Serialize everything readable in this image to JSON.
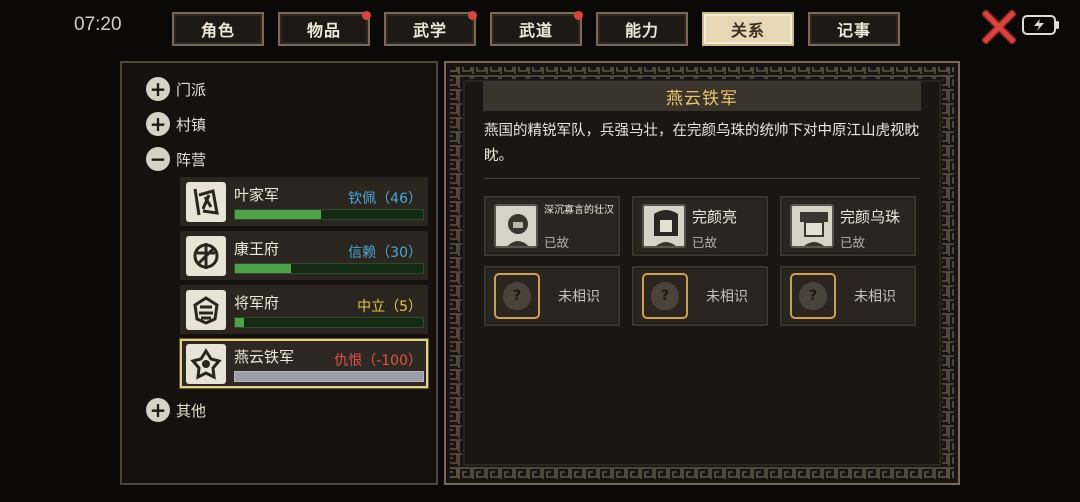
{
  "status_bar": {
    "time": "07:20"
  },
  "tabs": [
    {
      "label": "角色",
      "active": false,
      "badge": false
    },
    {
      "label": "物品",
      "active": false,
      "badge": true
    },
    {
      "label": "武学",
      "active": false,
      "badge": true
    },
    {
      "label": "武道",
      "active": false,
      "badge": true
    },
    {
      "label": "能力",
      "active": false,
      "badge": false
    },
    {
      "label": "关系",
      "active": true,
      "badge": false
    },
    {
      "label": "记事",
      "active": false,
      "badge": false
    }
  ],
  "colors": {
    "accent_gold": "#ebc56b",
    "friendly_blue": "#4aa8d8",
    "neutral_yellow": "#e6c84b",
    "hostile_red": "#e0524a",
    "bar_green": "#4ea24a"
  },
  "tree": {
    "sect": {
      "icon": "plus-icon",
      "label": "门派"
    },
    "town": {
      "icon": "plus-icon",
      "label": "村镇"
    },
    "camp": {
      "icon": "minus-icon",
      "label": "阵营"
    },
    "other": {
      "icon": "plus-icon",
      "label": "其他"
    }
  },
  "factions": [
    {
      "name": "叶家军",
      "status": "钦佩（46）",
      "tone": "friendly",
      "progress": 0.46
    },
    {
      "name": "康王府",
      "status": "信赖（30）",
      "tone": "friendly",
      "progress": 0.3
    },
    {
      "name": "将军府",
      "status": "中立（5）",
      "tone": "neutral",
      "progress": 0.05
    },
    {
      "name": "燕云铁军",
      "status": "仇恨（-100）",
      "tone": "hostile",
      "progress": 1.0,
      "selected": true
    }
  ],
  "detail": {
    "title": "燕云铁军",
    "description": "燕国的精锐军队，兵强马壮，在完颜乌珠的统帅下对中原江山虎视眈眈。",
    "members": [
      {
        "name": "深沉寡言的壮汉",
        "state": "已故"
      },
      {
        "name": "完颜亮",
        "state": "已故"
      },
      {
        "name": "完颜乌珠",
        "state": "已故"
      }
    ],
    "unknown_label": "未相识",
    "unknown_mark": "?"
  }
}
